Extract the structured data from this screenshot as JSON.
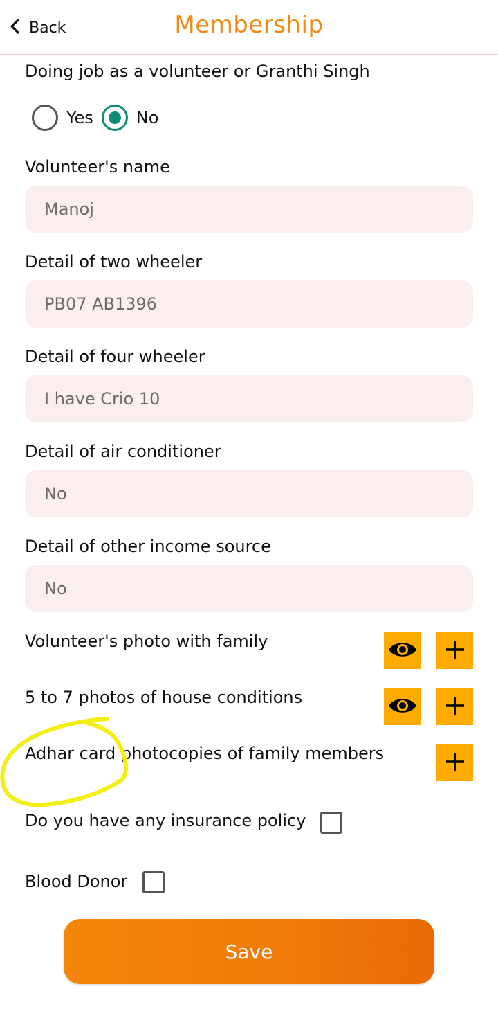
{
  "header": {
    "back_label": "Back",
    "title": "Membership",
    "title_color": "#f08a12"
  },
  "form": {
    "volunteer_job": {
      "label": "Doing job as a volunteer or Granthi Singh",
      "options": [
        {
          "label": "Yes",
          "selected": false
        },
        {
          "label": "No",
          "selected": true
        }
      ]
    },
    "volunteer_name": {
      "label": "Volunteer's name",
      "value": "Manoj"
    },
    "two_wheeler": {
      "label": "Detail of two wheeler",
      "value": "PB07 AB1396"
    },
    "four_wheeler": {
      "label": "Detail of four wheeler",
      "value": "I have Crio 10"
    },
    "air_conditioner": {
      "label": "Detail of air conditioner",
      "value": "No"
    },
    "other_income": {
      "label": "Detail of other income source",
      "value": "No"
    },
    "photo_family": {
      "label": "Volunteer's photo with family",
      "icons": [
        "eye-icon",
        "plus-icon"
      ]
    },
    "house_photos": {
      "label": "5 to 7 photos of house conditions",
      "icons": [
        "eye-icon",
        "plus-icon"
      ]
    },
    "adhar": {
      "label": "Adhar card photocopies of family members",
      "icons": [
        "plus-icon"
      ]
    },
    "insurance": {
      "label": "Do you have any insurance policy",
      "checked": false
    },
    "blood_donor": {
      "label": "Blood Donor",
      "checked": false
    }
  },
  "save_label": "Save",
  "colors": {
    "accent": "#f08a12",
    "radio_selected": "#0f8b7a",
    "icon_button": "#ffab00",
    "field_bg": "#fbeeee",
    "annotation": "#f5ee14"
  }
}
